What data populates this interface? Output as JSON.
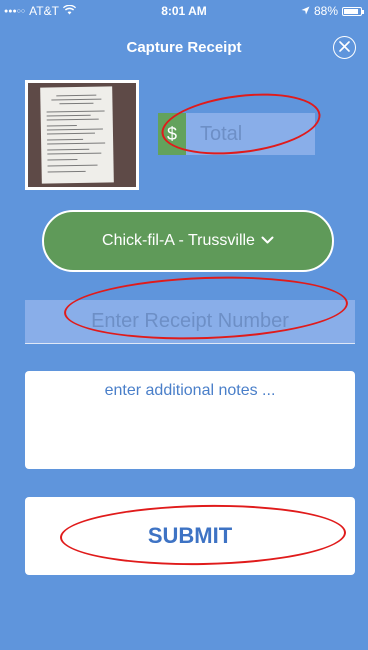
{
  "status_bar": {
    "signal": "●●●○○",
    "carrier": "AT&T",
    "time": "8:01 AM",
    "battery_percent": "88%",
    "battery_level": 0.88,
    "icons": [
      "wifi-icon",
      "location-arrow-icon",
      "battery-icon"
    ]
  },
  "header": {
    "title": "Capture Receipt",
    "close_icon": "close-circle-icon"
  },
  "receipt_photo": {
    "icon": "receipt-thumbnail"
  },
  "total": {
    "currency_symbol": "$",
    "placeholder": "Total"
  },
  "location": {
    "label": "Chick-fil-A - Trussville",
    "chevron_icon": "chevron-down-icon"
  },
  "receipt_number": {
    "placeholder": "Enter Receipt Number"
  },
  "notes": {
    "placeholder": "enter additional notes ..."
  },
  "submit": {
    "label": "SUBMIT"
  },
  "colors": {
    "background": "#5f95dc",
    "accent_green": "#5f9a59",
    "annotation_red": "#e01b1b",
    "field_fill": "#89aee9"
  }
}
